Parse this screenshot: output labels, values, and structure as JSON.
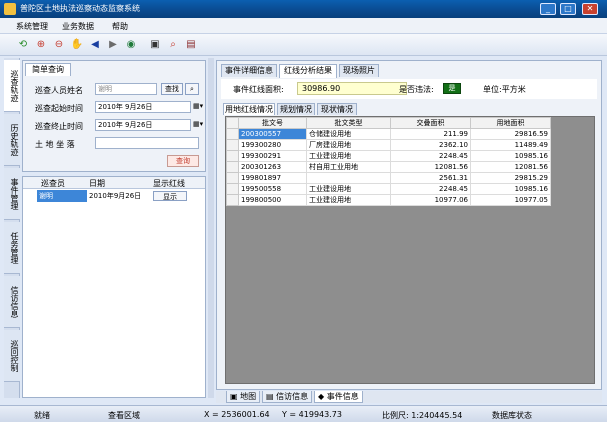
{
  "window": {
    "title": "普陀区土地执法巡察动态监察系统"
  },
  "menu": {
    "items": [
      "系统管理",
      "业务数据",
      "帮助"
    ]
  },
  "toolbar": {
    "icons": [
      "refresh-icon",
      "zoom-in-icon",
      "zoom-out-icon",
      "pan-hand-icon",
      "back-arrow-icon",
      "forward-arrow-icon",
      "globe-icon",
      "map-icon",
      "search-map-icon",
      "layers-icon"
    ]
  },
  "side_tabs": [
    "巡查轨迹",
    "历史轨迹",
    "事件管理",
    "任务管理",
    "信访信息",
    "巡回控制"
  ],
  "query": {
    "tab_label": "简单查询",
    "inspector_label": "巡查人员姓名",
    "inspector_value": "谢明",
    "search_btn": "查找",
    "start_label": "巡查起始时间",
    "start_value": "2010年 9月26日",
    "end_label": "巡查终止时间",
    "end_value": "2010年 9月26日",
    "location_label": "土 地 坐 落",
    "location_value": "",
    "query_btn": "查询"
  },
  "results": {
    "headers": [
      "巡查员",
      "日期",
      "显示红线"
    ],
    "rows": [
      {
        "inspector": "谢明",
        "date": "2010年9月26日",
        "action": "显示"
      }
    ]
  },
  "main": {
    "top_tabs": [
      "事件详细信息",
      "红线分析结果",
      "现场照片"
    ],
    "active_top_tab": 1,
    "area_label": "事件红线面积:",
    "area_value": "30986.90",
    "violation_label": "是否违法:",
    "violation_value": "是",
    "unit_label": "单位:平方米",
    "sub_tabs": [
      "用地红线情况",
      "规划情况",
      "现状情况"
    ],
    "active_sub_tab": 0,
    "grid": {
      "headers": [
        "批文号",
        "批文类型",
        "交叠面积",
        "用地面积"
      ],
      "rows": [
        {
          "no": "200300557",
          "type": "仓储建设用地",
          "overlap": "211.99",
          "area": "29816.59"
        },
        {
          "no": "199300280",
          "type": "厂房建设用地",
          "overlap": "2362.10",
          "area": "11489.49"
        },
        {
          "no": "199300291",
          "type": "工业建设用地",
          "overlap": "2248.45",
          "area": "10985.16"
        },
        {
          "no": "200301263",
          "type": "村自用工业用地",
          "overlap": "12081.56",
          "area": "12081.56"
        },
        {
          "no": "199801897",
          "type": "",
          "overlap": "2561.31",
          "area": "29815.29"
        },
        {
          "no": "199500558",
          "type": "工业建设用地",
          "overlap": "2248.45",
          "area": "10985.16"
        },
        {
          "no": "199800500",
          "type": "工业建设用地",
          "overlap": "10977.06",
          "area": "10977.05"
        }
      ]
    }
  },
  "bottom_tabs": [
    "地图",
    "信访信息",
    "事件信息"
  ],
  "active_bottom_tab": 2,
  "status": {
    "ready": "就绪",
    "area": "查看区域",
    "x": "X = 2536001.64",
    "y": "Y = 419943.73",
    "scale": "比例尺: 1:240445.54",
    "db": "数据库状态"
  }
}
